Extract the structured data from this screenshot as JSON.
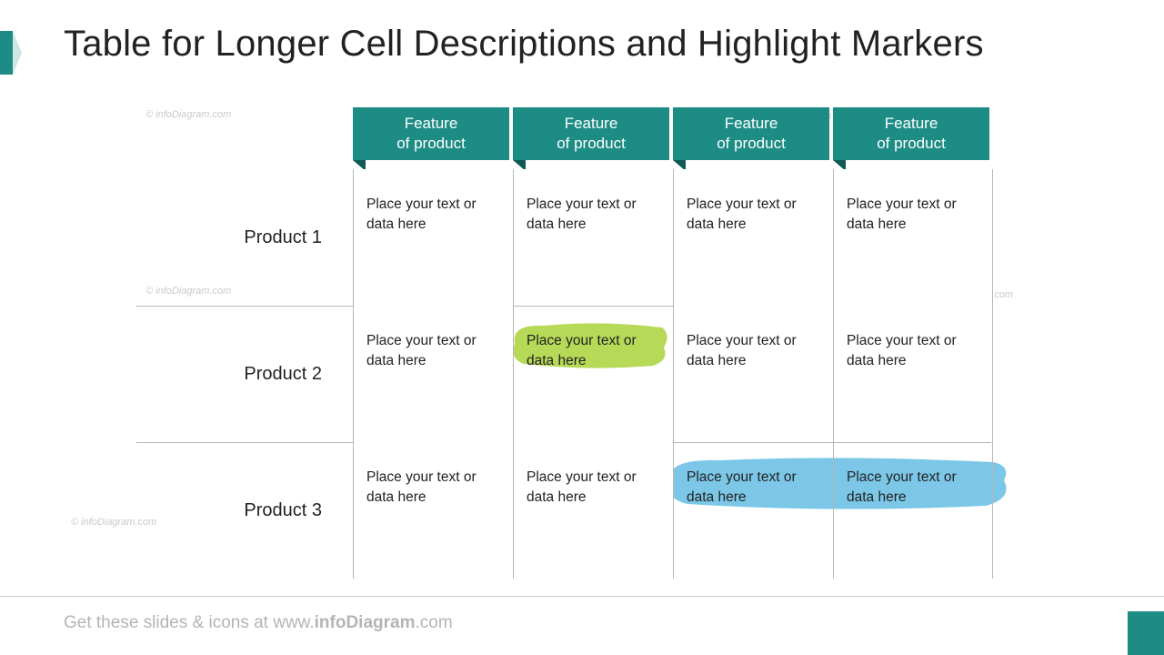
{
  "title": "Table for Longer Cell Descriptions and Highlight Markers",
  "watermark": "© infoDiagram.com",
  "columns": [
    {
      "line1": "Feature",
      "line2": "of product"
    },
    {
      "line1": "Feature",
      "line2": "of product"
    },
    {
      "line1": "Feature",
      "line2": "of product"
    },
    {
      "line1": "Feature",
      "line2": "of product"
    }
  ],
  "rows": [
    {
      "label": "Product 1",
      "cells": [
        "Place your text or data here",
        "Place your text or data here",
        "Place your text or data here",
        "Place your text or data here"
      ]
    },
    {
      "label": "Product 2",
      "cells": [
        "Place your text or data here",
        "Place your text or data here",
        "Place your text or data here",
        "Place your text or data here"
      ]
    },
    {
      "label": "Product 3",
      "cells": [
        "Place your text or data here",
        "Place your text or data here",
        "Place your text or data here",
        "Place your text or data here"
      ]
    }
  ],
  "highlights": {
    "green": "#b6d957",
    "blue": "#7cc7e8"
  },
  "footer": {
    "pre": "Get these slides & icons at www.",
    "bold": "infoDiagram",
    "post": ".com"
  }
}
